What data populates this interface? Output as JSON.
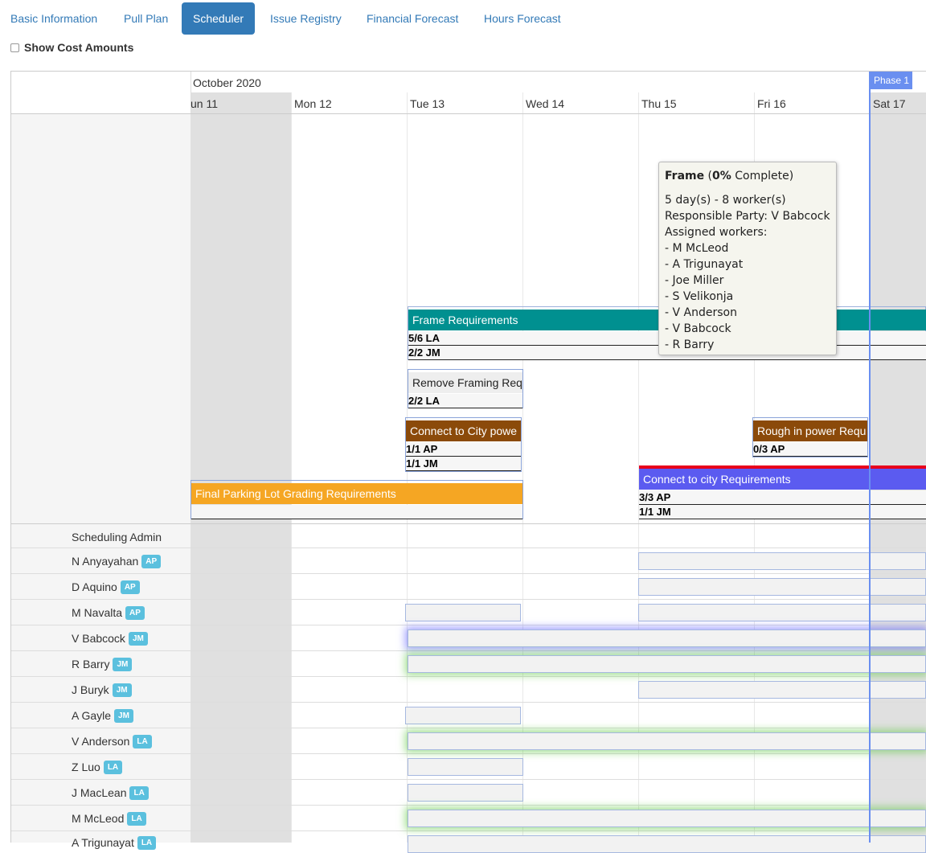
{
  "tabs": [
    {
      "label": "Basic Information"
    },
    {
      "label": "Pull Plan"
    },
    {
      "label": "Scheduler"
    },
    {
      "label": "Issue Registry"
    },
    {
      "label": "Financial Forecast"
    },
    {
      "label": "Hours Forecast"
    }
  ],
  "show_cost": {
    "label": "Show Cost Amounts",
    "checked": false
  },
  "calendar": {
    "month": "October 2020",
    "days": [
      "un 11",
      "Mon 12",
      "Tue 13",
      "Wed 14",
      "Thu 15",
      "Fri 16",
      "Sat 17"
    ],
    "phase_label": "Phase 1"
  },
  "tasks": {
    "frame_req": {
      "name": "Frame Requirements",
      "stats": [
        "5/6 LA",
        "2/2 JM"
      ],
      "color": "#009090"
    },
    "remove_framing": {
      "name": "Remove Framing Requ",
      "stats": [
        "2/2 LA"
      ],
      "color": "#f0f0f0"
    },
    "connect_city_power": {
      "name": "Connect to City powe",
      "stats": [
        "1/1 AP",
        "1/1 JM"
      ],
      "color": "#8b4a0a"
    },
    "rough_power": {
      "name": "Rough in power Requ",
      "stats": [
        "0/3 AP"
      ],
      "color": "#8b4a0a"
    },
    "final_parking": {
      "name": "Final Parking Lot Grading Requirements",
      "stats": [],
      "color": "#f5a623"
    },
    "connect_city": {
      "name": "Connect to city Requirements",
      "stats": [
        "3/3 AP",
        "1/1 JM"
      ],
      "color": "#5b5bf0"
    }
  },
  "tooltip": {
    "task": "Frame",
    "percent": "0%",
    "complete_word": "Complete",
    "duration": "5 day(s) - 8 worker(s)",
    "responsible": "Responsible Party: V Babcock",
    "assigned_header": "Assigned workers:",
    "workers": [
      "- M McLeod",
      "- A Trigunayat",
      "- Joe Miller",
      "- S Velikonja",
      "- V Anderson",
      "- V Babcock",
      "- R Barry"
    ]
  },
  "workers": [
    {
      "name": "Scheduling Admin",
      "badge": ""
    },
    {
      "name": "N Anyayahan",
      "badge": "AP"
    },
    {
      "name": "D Aquino",
      "badge": "AP"
    },
    {
      "name": "M Navalta",
      "badge": "AP"
    },
    {
      "name": "V Babcock",
      "badge": "JM"
    },
    {
      "name": "R Barry",
      "badge": "JM"
    },
    {
      "name": "J Buryk",
      "badge": "JM"
    },
    {
      "name": "A Gayle",
      "badge": "JM"
    },
    {
      "name": "V Anderson",
      "badge": "LA"
    },
    {
      "name": "Z Luo",
      "badge": "LA"
    },
    {
      "name": "J MacLean",
      "badge": "LA"
    },
    {
      "name": "M McLeod",
      "badge": "LA"
    },
    {
      "name": "A Trigunayat",
      "badge": "LA"
    }
  ]
}
